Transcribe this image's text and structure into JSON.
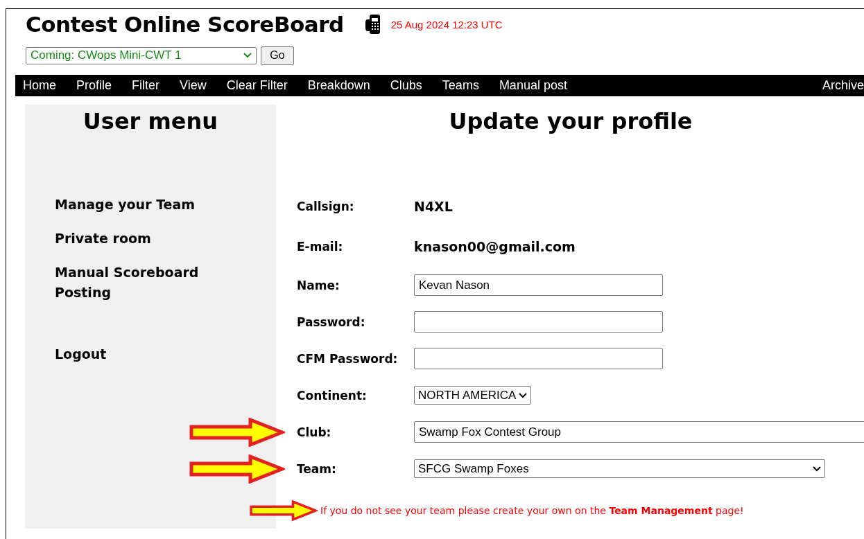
{
  "header": {
    "title": "Contest Online ScoreBoard",
    "datetime": "25 Aug 2024 12:23 UTC"
  },
  "contest_select": {
    "value": "Coming: CWops Mini-CWT 1"
  },
  "go_button": "Go",
  "nav": {
    "items": [
      "Home",
      "Profile",
      "Filter",
      "View",
      "Clear Filter",
      "Breakdown",
      "Clubs",
      "Teams",
      "Manual post"
    ],
    "right_items": [
      "Archive"
    ]
  },
  "sidebar": {
    "title": "User menu",
    "items": [
      "Manage your Team",
      "Private room",
      "Manual Scoreboard Posting",
      "Logout"
    ]
  },
  "form": {
    "title": "Update your profile",
    "fields": [
      {
        "kind": "text",
        "label": "Callsign:",
        "value": "N4XL",
        "arrow": false
      },
      {
        "kind": "text",
        "label": "E-mail:",
        "value": "knason00@gmail.com",
        "arrow": false
      },
      {
        "kind": "input",
        "label": "Name:",
        "value": "Kevan Nason",
        "arrow": false
      },
      {
        "kind": "input",
        "label": "Password:",
        "arrow": false
      },
      {
        "kind": "input",
        "label": "CFM Password:",
        "arrow": false
      },
      {
        "kind": "select",
        "label": "Continent:",
        "value": "NORTH AMERICA",
        "arrow": false
      },
      {
        "kind": "input",
        "label": "Club:",
        "value": "Swamp Fox Contest Group",
        "arrow": true
      },
      {
        "kind": "select",
        "label": "Team:",
        "value": "SFCG Swamp Foxes",
        "arrow": true
      }
    ],
    "note": {
      "text": "If you do not see your team please create your own on the **Team Management** page!",
      "arrow": true
    }
  }
}
